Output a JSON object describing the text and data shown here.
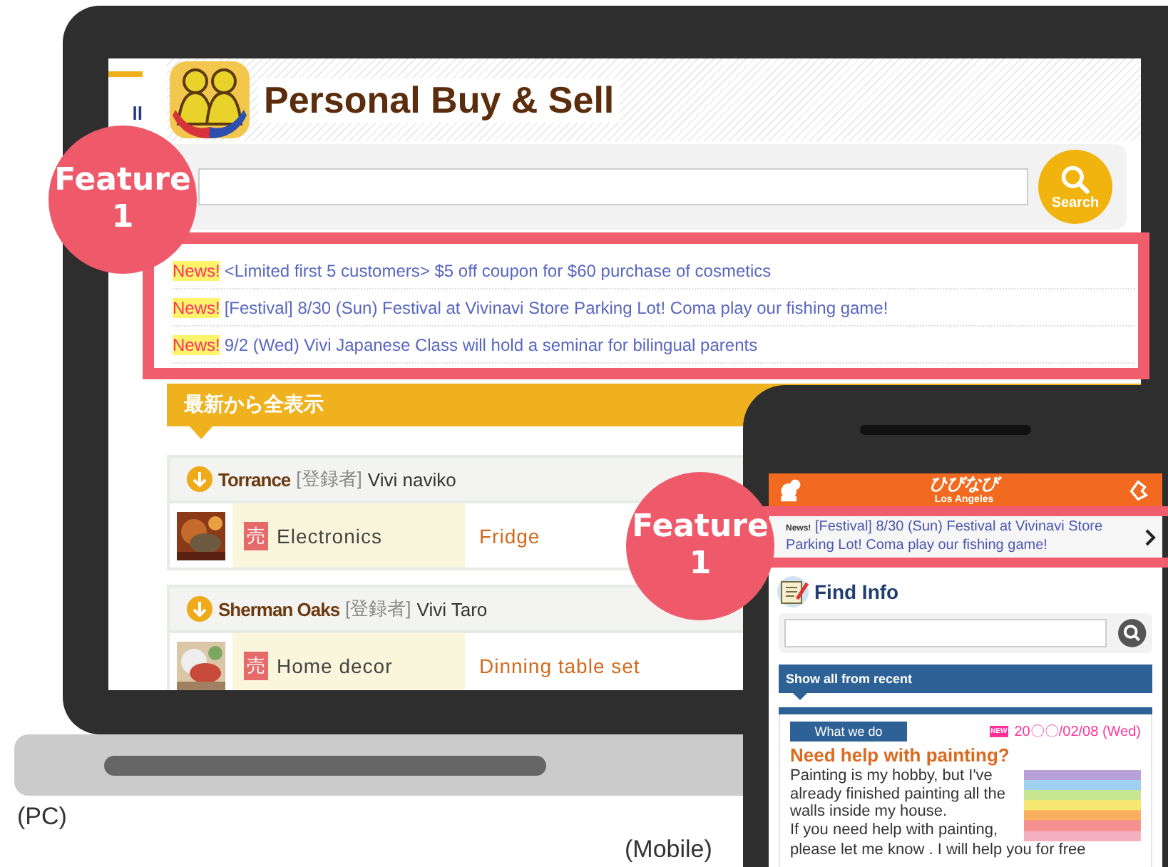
{
  "pc": {
    "label": "(PC)",
    "nav_fragment": "ll",
    "site_title": "Personal Buy & Sell",
    "search": {
      "button": "Search"
    },
    "news": [
      {
        "tag": "News!",
        "text": "<Limited first 5 customers> $5 off coupon for $60 purchase of cosmetics"
      },
      {
        "tag": "News!",
        "text": "[Festival] 8/30 (Sun) Festival at Vivinavi Store Parking Lot! Coma play our fishing game!"
      },
      {
        "tag": "News!",
        "text": "9/2 (Wed) Vivi Japanese Class will hold a seminar for bilingual parents"
      }
    ],
    "section_title": "最新から全表示",
    "listings": [
      {
        "area": "Torrance",
        "registrant_label": "[登録者]",
        "registrant": "Vivi naviko",
        "type": "売",
        "category": "Electronics",
        "item": "Fridge"
      },
      {
        "area": "Sherman Oaks",
        "registrant_label": "[登録者]",
        "registrant": "Vivi Taro",
        "type": "売",
        "category": "Home decor",
        "item": "Dinning table set"
      }
    ]
  },
  "mobile": {
    "label": "(Mobile)",
    "logo": "ひびなび",
    "city": "Los Angeles",
    "news": {
      "tag": "News!",
      "text": "[Festival] 8/30 (Sun) Festival at Vivinavi Store Parking Lot! Coma play our fishing game!"
    },
    "find_title": "Find Info",
    "section_title": "Show all from recent",
    "post": {
      "category": "What we do",
      "badge": "NEW",
      "date": "20〇〇/02/08 (Wed)",
      "title": "Need help with painting?",
      "body": [
        "Painting is my hobby, but I've already finished painting all the walls inside my house.",
        "If you need help with painting,",
        "please let me know . I will help you for free"
      ]
    }
  },
  "features": [
    {
      "label": "Feature",
      "number": "1"
    },
    {
      "label": "Feature",
      "number": "1"
    }
  ]
}
